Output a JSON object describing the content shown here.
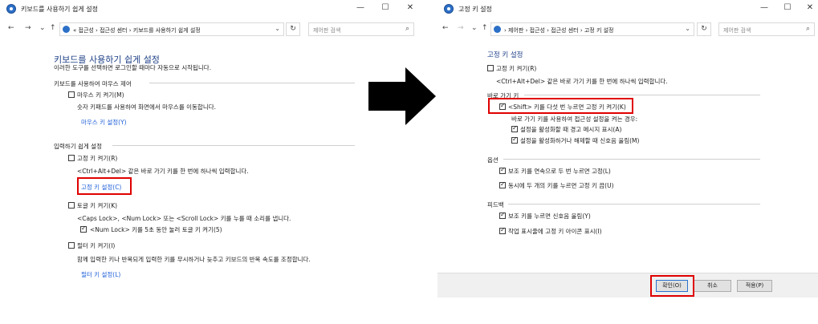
{
  "left_window": {
    "title": "키보드를 사용하기 쉽게 설정",
    "controls": {
      "minimize": "—",
      "maximize": "☐",
      "close": "✕"
    },
    "nav": {
      "back": "←",
      "forward": "→",
      "dropdown": "⌄",
      "up": "↑"
    },
    "breadcrumbs": "« 접근성 › 접근성 센터 › 키보드를 사용하기 쉽게 설정",
    "search_placeholder": "제어판 검색",
    "page_title": "키보드를 사용하기 쉽게 설정",
    "page_subtitle": "이러한 도구를 선택하면 로그인할 때마다 자동으로 시작됩니다.",
    "mouse_section": {
      "title": "키보드를 사용하여 마우스 제어",
      "mouse_keys_label": "마우스 키 켜기(M)",
      "mouse_keys_checked": false,
      "mouse_keys_desc": "숫자 키패드를 사용하여 화면에서 마우스를 이동합니다.",
      "mouse_keys_link": "마우스 키 설정(Y)"
    },
    "typing_section": {
      "title": "입력하기 쉽게 설정",
      "sticky_label": "고정 키 켜기(R)",
      "sticky_checked": false,
      "sticky_desc": "<Ctrl+Alt+Del> 같은 바로 가기 키를 한 번에 하나씩 입력합니다.",
      "sticky_link": "고정 키 설정(C)",
      "toggle_label": "토글 키 켜기(K)",
      "toggle_checked": false,
      "toggle_desc": "<Caps Lock>, <Num Lock> 또는 <Scroll Lock> 키를 누를 때 소리를 냅니다.",
      "numlock_label": "<Num Lock> 키를 5초 동안 눌러 토글 키 켜기(5)",
      "numlock_checked": true,
      "filter_label": "필터 키 켜기(I)",
      "filter_checked": false,
      "filter_desc": "함께 입력한 키나 반복되게 입력한 키를 무시하거나 늦추고 키보드의 반복 속도를 조정합니다.",
      "filter_link": "필터 키 설정(L)"
    }
  },
  "right_window": {
    "title": "고정 키 설정",
    "controls": {
      "minimize": "—",
      "maximize": "☐",
      "close": "✕"
    },
    "nav": {
      "back": "←",
      "forward": "→",
      "dropdown": "⌄",
      "up": "↑"
    },
    "breadcrumbs": "› 제어판 › 접근성 › 접근성 센터 › 고정 키 설정",
    "search_placeholder": "제어판 검색",
    "page_title": "고정 키 설정",
    "sticky_on_label": "고정 키 켜기(R)",
    "sticky_on_checked": false,
    "sticky_on_desc": "<Ctrl+Alt+Del> 같은 바로 가기 키를 한 번에 하나씩 입력합니다.",
    "shortcut_section": {
      "title": "바로 가기 키",
      "shift5_label": "<Shift> 키를 다섯 번 누르면 고정 키 켜기(K)",
      "shift5_checked": true,
      "shortcut_desc": "바로 가기 키를 사용하여 접근성 설정을 켜는 경우:",
      "warn_label": "설정을 활성화할 때 경고 메시지 표시(A)",
      "warn_checked": true,
      "sound_label": "설정을 활성화하거나 해제할 때 신호음 울림(M)",
      "sound_checked": true
    },
    "options_section": {
      "title": "옵션",
      "lock_label": "보조 키를 연속으로 두 번 누르면 고정(L)",
      "lock_checked": true,
      "off_label": "동시에 두 개의 키를 누르면 고정 키 끔(U)",
      "off_checked": true
    },
    "feedback_section": {
      "title": "피드백",
      "beep_label": "보조 키를 누르면 신호음 울림(Y)",
      "beep_checked": true,
      "icon_label": "작업 표시줄에 고정 키 아이콘 표시(I)",
      "icon_checked": true
    },
    "buttons": {
      "ok": "확인(O)",
      "cancel": "취소",
      "apply": "적용(P)"
    }
  },
  "colors": {
    "highlight": "#e00000",
    "link": "#1e5fd8",
    "heading": "#1c3f86",
    "arrow": "#000000"
  }
}
